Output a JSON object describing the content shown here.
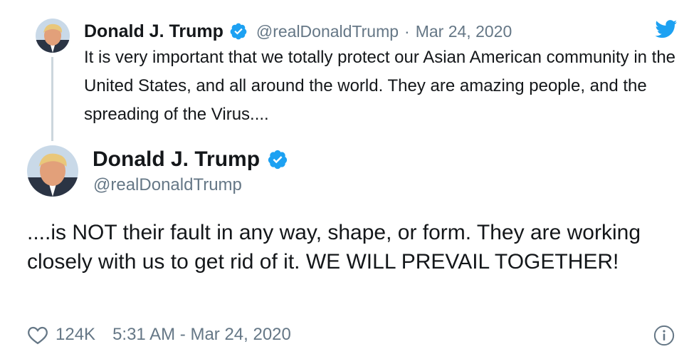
{
  "parent_tweet": {
    "name": "Donald J. Trump",
    "handle": "@realDonaldTrump",
    "separator": "·",
    "date": "Mar 24, 2020",
    "text": "It is very important that we totally protect our Asian American community in the United States, and all around the world. They are amazing people, and the spreading of the Virus....",
    "verified_icon": "verified-badge-icon",
    "avatar_icon": "avatar"
  },
  "main_tweet": {
    "name": "Donald J. Trump",
    "handle": "@realDonaldTrump",
    "text": "....is NOT their fault in any way, shape, or form. They are working closely with us to get rid of it. WE WILL PREVAIL TOGETHER!",
    "likes": "124K",
    "timestamp": "5:31 AM - Mar 24, 2020",
    "verified_icon": "verified-badge-icon",
    "avatar_icon": "avatar"
  },
  "icons": {
    "brand": "twitter-bird-icon",
    "like": "heart-icon",
    "info": "info-icon"
  },
  "colors": {
    "brand_blue": "#1da1f2",
    "text_primary": "#14171a",
    "text_secondary": "#657786",
    "thread_line": "#ccd6dd"
  }
}
